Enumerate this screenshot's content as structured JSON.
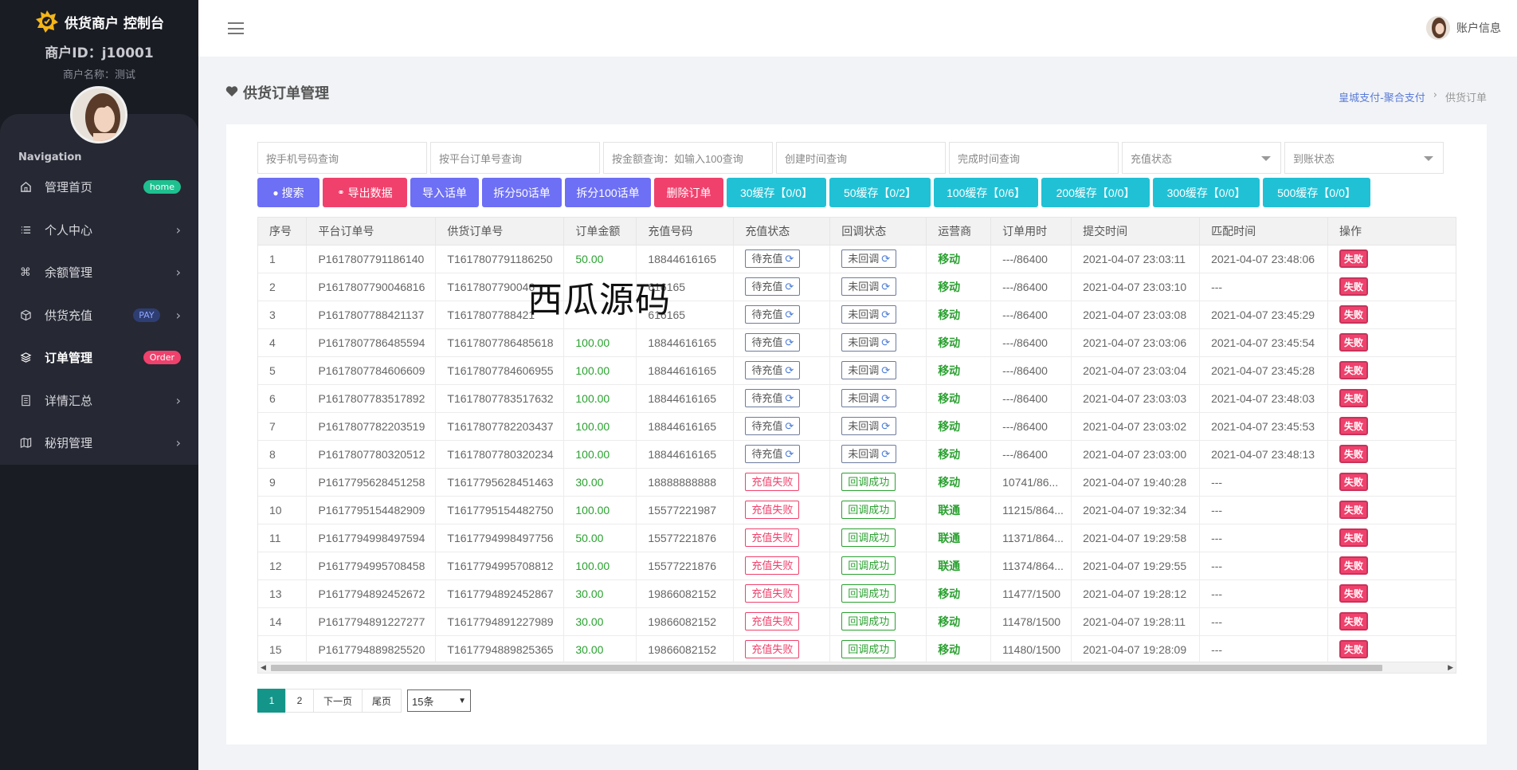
{
  "sidebar": {
    "brand": "供货商户 控制台",
    "merchant_id": "商户ID：j10001",
    "merchant_name": "商户名称：测试",
    "nav_title": "Navigation",
    "items": [
      {
        "label": "管理首页",
        "icon": "home-icon",
        "badge": "home",
        "badge_color": "#1fc08f"
      },
      {
        "label": "个人中心",
        "icon": "list-icon",
        "chevron": true
      },
      {
        "label": "余额管理",
        "icon": "command-icon",
        "chevron": true
      },
      {
        "label": "供货充值",
        "icon": "box-icon",
        "badge": "PAY",
        "chevron": true
      },
      {
        "label": "订单管理",
        "icon": "layers-icon",
        "badge": "Order",
        "badge_color": "#f0416c",
        "active": true
      },
      {
        "label": "详情汇总",
        "icon": "file-icon",
        "chevron": true
      },
      {
        "label": "秘钥管理",
        "icon": "map-icon",
        "chevron": true
      }
    ]
  },
  "topbar": {
    "account_label": "账户信息"
  },
  "page": {
    "title": "供货订单管理",
    "breadcrumb_link": "皇城支付-聚合支付",
    "breadcrumb_sep": "›",
    "breadcrumb_current": "供货订单"
  },
  "filters": {
    "phone": "按手机号码查询",
    "platform_order": "按平台订单号查询",
    "amount": "按金额查询：如输入100查询",
    "created": "创建时间查询",
    "completed": "完成时间查询",
    "recharge_status": "充值状态",
    "account_status": "到账状态"
  },
  "buttons": {
    "search": "搜索",
    "export": "导出数据",
    "import": "导入话单",
    "split50": "拆分50话单",
    "split100": "拆分100话单",
    "delete": "删除订单",
    "cache30": "30缓存【0/0】",
    "cache50": "50缓存【0/2】",
    "cache100": "100缓存【0/6】",
    "cache200": "200缓存【0/0】",
    "cache300": "300缓存【0/0】",
    "cache500": "500缓存【0/0】"
  },
  "table": {
    "headers": [
      "序号",
      "平台订单号",
      "供货订单号",
      "订单金额",
      "充值号码",
      "充值状态",
      "回调状态",
      "运营商",
      "订单用时",
      "提交时间",
      "匹配时间",
      "操作"
    ],
    "rows": [
      {
        "no": "1",
        "platform": "P1617807791186140",
        "supply": "T1617807791186250",
        "amount": "50.00",
        "phone": "18844616165",
        "status": "待充值",
        "status_type": "wait",
        "callback": "未回调",
        "callback_type": "wait",
        "carrier": "移动",
        "used": "---/86400",
        "submit": "2021-04-07 23:03:11",
        "match": "2021-04-07 23:48:06",
        "op": "失败"
      },
      {
        "no": "2",
        "platform": "P1617807790046816",
        "supply": "T1617807790046",
        "amount": "",
        "phone": "616165",
        "status": "待充值",
        "status_type": "wait",
        "callback": "未回调",
        "callback_type": "wait",
        "carrier": "移动",
        "used": "---/86400",
        "submit": "2021-04-07 23:03:10",
        "match": "---",
        "op": "失败"
      },
      {
        "no": "3",
        "platform": "P1617807788421137",
        "supply": "T1617807788421",
        "amount": "",
        "phone": "616165",
        "status": "待充值",
        "status_type": "wait",
        "callback": "未回调",
        "callback_type": "wait",
        "carrier": "移动",
        "used": "---/86400",
        "submit": "2021-04-07 23:03:08",
        "match": "2021-04-07 23:45:29",
        "op": "失败"
      },
      {
        "no": "4",
        "platform": "P1617807786485594",
        "supply": "T1617807786485618",
        "amount": "100.00",
        "phone": "18844616165",
        "status": "待充值",
        "status_type": "wait",
        "callback": "未回调",
        "callback_type": "wait",
        "carrier": "移动",
        "used": "---/86400",
        "submit": "2021-04-07 23:03:06",
        "match": "2021-04-07 23:45:54",
        "op": "失败"
      },
      {
        "no": "5",
        "platform": "P1617807784606609",
        "supply": "T1617807784606955",
        "amount": "100.00",
        "phone": "18844616165",
        "status": "待充值",
        "status_type": "wait",
        "callback": "未回调",
        "callback_type": "wait",
        "carrier": "移动",
        "used": "---/86400",
        "submit": "2021-04-07 23:03:04",
        "match": "2021-04-07 23:45:28",
        "op": "失败"
      },
      {
        "no": "6",
        "platform": "P1617807783517892",
        "supply": "T1617807783517632",
        "amount": "100.00",
        "phone": "18844616165",
        "status": "待充值",
        "status_type": "wait",
        "callback": "未回调",
        "callback_type": "wait",
        "carrier": "移动",
        "used": "---/86400",
        "submit": "2021-04-07 23:03:03",
        "match": "2021-04-07 23:48:03",
        "op": "失败"
      },
      {
        "no": "7",
        "platform": "P1617807782203519",
        "supply": "T1617807782203437",
        "amount": "100.00",
        "phone": "18844616165",
        "status": "待充值",
        "status_type": "wait",
        "callback": "未回调",
        "callback_type": "wait",
        "carrier": "移动",
        "used": "---/86400",
        "submit": "2021-04-07 23:03:02",
        "match": "2021-04-07 23:45:53",
        "op": "失败"
      },
      {
        "no": "8",
        "platform": "P1617807780320512",
        "supply": "T1617807780320234",
        "amount": "100.00",
        "phone": "18844616165",
        "status": "待充值",
        "status_type": "wait",
        "callback": "未回调",
        "callback_type": "wait",
        "carrier": "移动",
        "used": "---/86400",
        "submit": "2021-04-07 23:03:00",
        "match": "2021-04-07 23:48:13",
        "op": "失败"
      },
      {
        "no": "9",
        "platform": "P1617795628451258",
        "supply": "T1617795628451463",
        "amount": "30.00",
        "phone": "18888888888",
        "status": "充值失败",
        "status_type": "fail",
        "callback": "回调成功",
        "callback_type": "ok",
        "carrier": "移动",
        "used": "10741/86...",
        "submit": "2021-04-07 19:40:28",
        "match": "---",
        "op": "失败"
      },
      {
        "no": "10",
        "platform": "P1617795154482909",
        "supply": "T1617795154482750",
        "amount": "100.00",
        "phone": "15577221987",
        "status": "充值失败",
        "status_type": "fail",
        "callback": "回调成功",
        "callback_type": "ok",
        "carrier": "联通",
        "used": "11215/864...",
        "submit": "2021-04-07 19:32:34",
        "match": "---",
        "op": "失败"
      },
      {
        "no": "11",
        "platform": "P1617794998497594",
        "supply": "T1617794998497756",
        "amount": "50.00",
        "phone": "15577221876",
        "status": "充值失败",
        "status_type": "fail",
        "callback": "回调成功",
        "callback_type": "ok",
        "carrier": "联通",
        "used": "11371/864...",
        "submit": "2021-04-07 19:29:58",
        "match": "---",
        "op": "失败"
      },
      {
        "no": "12",
        "platform": "P1617794995708458",
        "supply": "T1617794995708812",
        "amount": "100.00",
        "phone": "15577221876",
        "status": "充值失败",
        "status_type": "fail",
        "callback": "回调成功",
        "callback_type": "ok",
        "carrier": "联通",
        "used": "11374/864...",
        "submit": "2021-04-07 19:29:55",
        "match": "---",
        "op": "失败"
      },
      {
        "no": "13",
        "platform": "P1617794892452672",
        "supply": "T1617794892452867",
        "amount": "30.00",
        "phone": "19866082152",
        "status": "充值失败",
        "status_type": "fail",
        "callback": "回调成功",
        "callback_type": "ok",
        "carrier": "移动",
        "used": "11477/1500",
        "submit": "2021-04-07 19:28:12",
        "match": "---",
        "op": "失败"
      },
      {
        "no": "14",
        "platform": "P1617794891227277",
        "supply": "T1617794891227989",
        "amount": "30.00",
        "phone": "19866082152",
        "status": "充值失败",
        "status_type": "fail",
        "callback": "回调成功",
        "callback_type": "ok",
        "carrier": "移动",
        "used": "11478/1500",
        "submit": "2021-04-07 19:28:11",
        "match": "---",
        "op": "失败"
      },
      {
        "no": "15",
        "platform": "P1617794889825520",
        "supply": "T1617794889825365",
        "amount": "30.00",
        "phone": "19866082152",
        "status": "充值失败",
        "status_type": "fail",
        "callback": "回调成功",
        "callback_type": "ok",
        "carrier": "移动",
        "used": "11480/1500",
        "submit": "2021-04-07 19:28:09",
        "match": "---",
        "op": "失败"
      }
    ]
  },
  "watermark": "西瓜源码",
  "pagination": {
    "pages": [
      "1",
      "2"
    ],
    "current": "1",
    "next": "下一页",
    "last": "尾页",
    "per_page": "15条"
  },
  "colors": {
    "sidebar_bg": "#1a1c24",
    "accent_purple": "#6d6ff5",
    "accent_pink": "#f0416c",
    "accent_cyan": "#21c1d5",
    "green": "#2aa130",
    "pager_active": "#149589"
  }
}
